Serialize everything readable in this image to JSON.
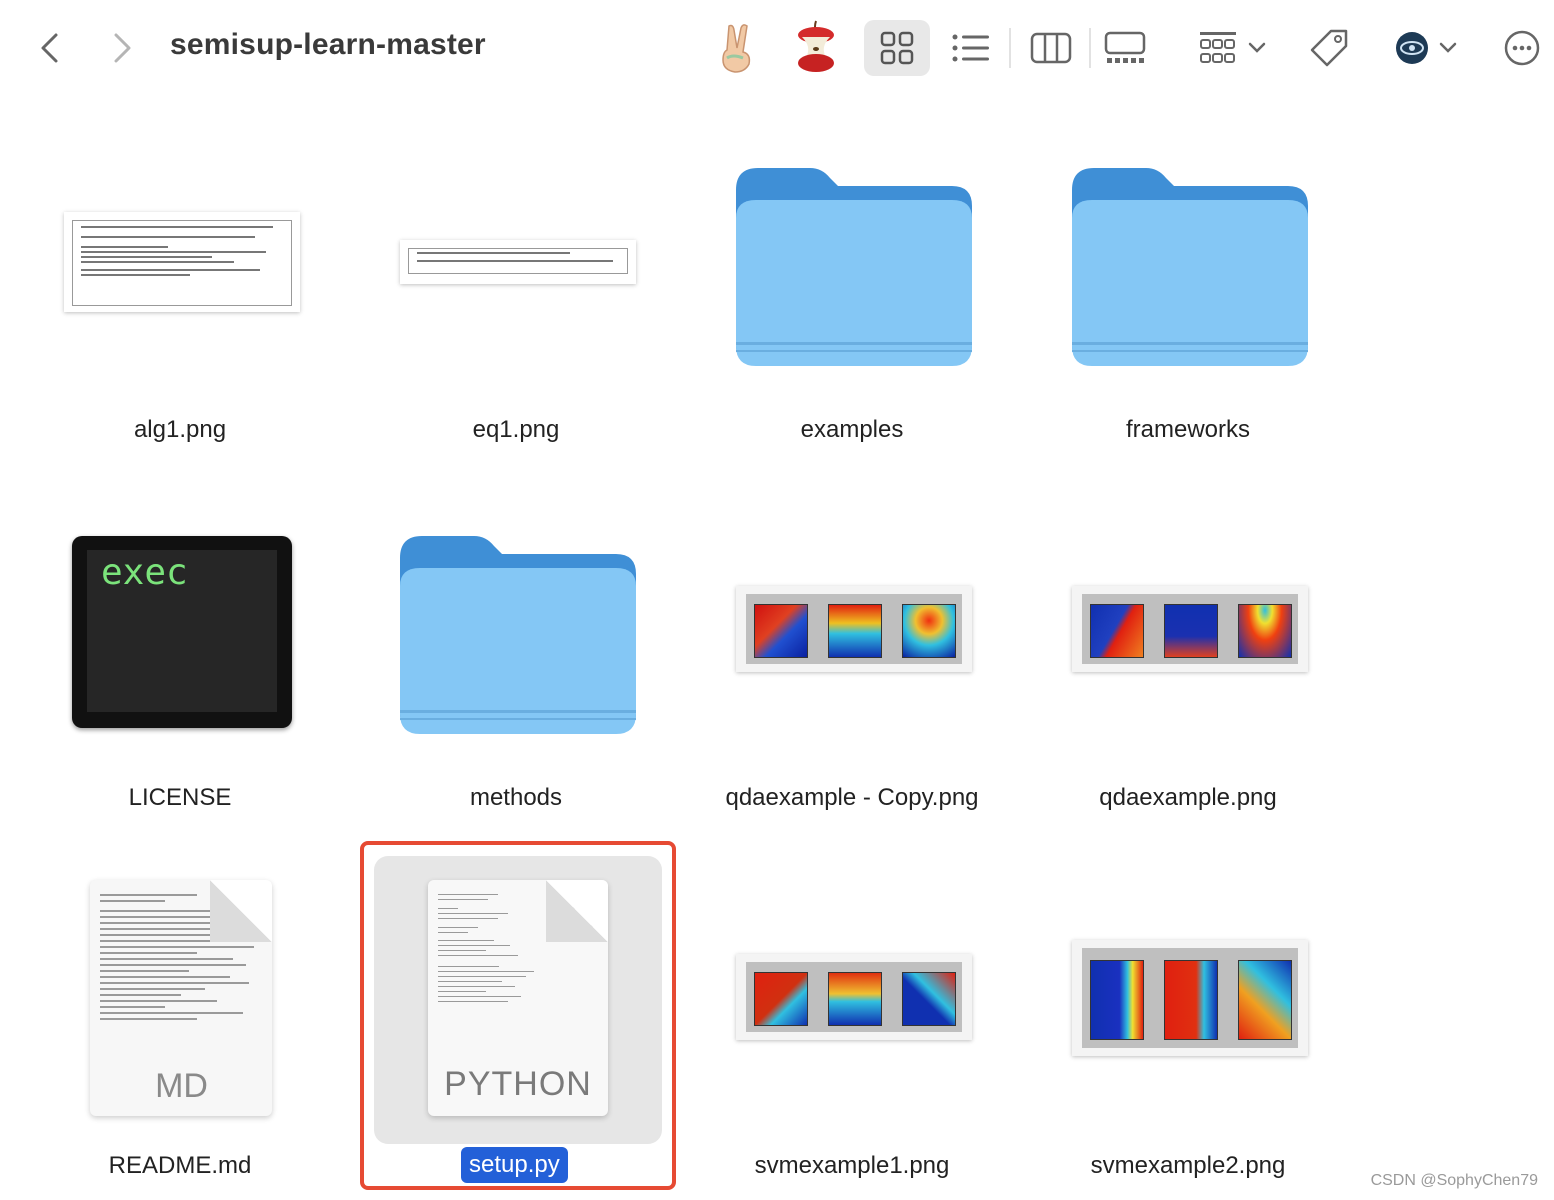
{
  "toolbar": {
    "back": "back-button",
    "forward": "forward-button",
    "title": "semisup-learn-master"
  },
  "files": [
    {
      "name": "alg1.png"
    },
    {
      "name": "eq1.png"
    },
    {
      "name": "examples"
    },
    {
      "name": "frameworks"
    },
    {
      "name": "LICENSE"
    },
    {
      "name": "methods"
    },
    {
      "name": "qdaexample - Copy.png"
    },
    {
      "name": "qdaexample.png"
    },
    {
      "name": "README.md"
    },
    {
      "name": "setup.py"
    },
    {
      "name": "svmexample1.png"
    },
    {
      "name": "svmexample2.png"
    }
  ],
  "icons": {
    "exec_text": "exec",
    "python_text": "PYTHON",
    "md_text": "MD"
  },
  "selected": "setup.py",
  "watermark": "CSDN @SophyChen79",
  "colors": {
    "folder": "#74bff1",
    "selection_border": "#e64a33",
    "selection_label": "#2360d8"
  }
}
